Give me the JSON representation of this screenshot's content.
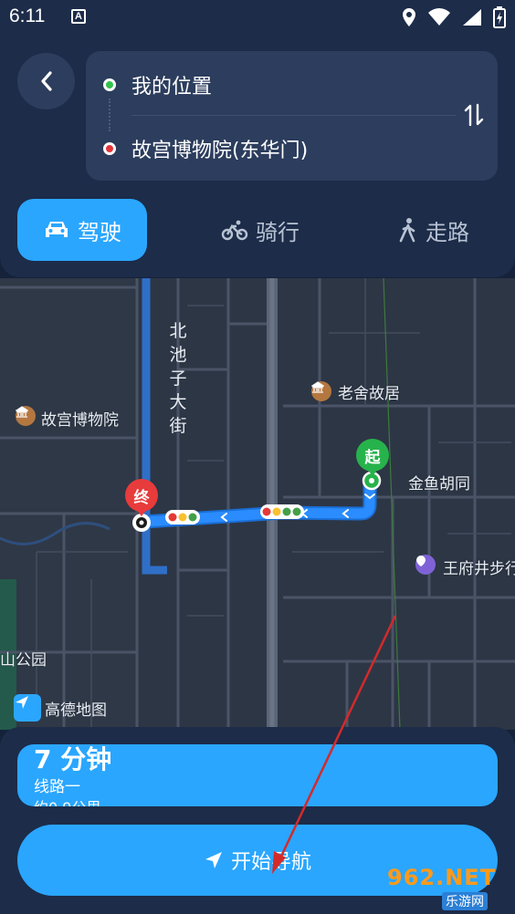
{
  "status_bar": {
    "time": "6:11",
    "notification_icon": "A"
  },
  "route": {
    "from": "我的位置",
    "to": "故宫博物院(东华门)"
  },
  "modes": [
    {
      "label": "驾驶",
      "icon": "car-icon",
      "selected": true
    },
    {
      "label": "骑行",
      "icon": "bike-icon",
      "selected": false
    },
    {
      "label": "走路",
      "icon": "walk-icon",
      "selected": false
    }
  ],
  "map": {
    "street_north_chizi": "北池子大街",
    "poi_laoshe": "老舍故居",
    "poi_palace_museum": "故宫博物院",
    "poi_jinyu_hutong": "金鱼胡同",
    "poi_wangfujing": "王府井步行",
    "poi_park": "山公园",
    "end_marker": "终",
    "start_marker": "起",
    "logo": "高德地图"
  },
  "plan": {
    "duration": "7 分钟",
    "route_name": "线路一",
    "distance": "约0.9公里"
  },
  "start_button": "开始导航",
  "watermark": {
    "top": "962.NET",
    "bottom": "乐游网"
  },
  "colors": {
    "accent": "#2aa6ff",
    "panel": "#1c2c49",
    "start_green": "#27b34b",
    "end_red": "#e83b3b"
  }
}
